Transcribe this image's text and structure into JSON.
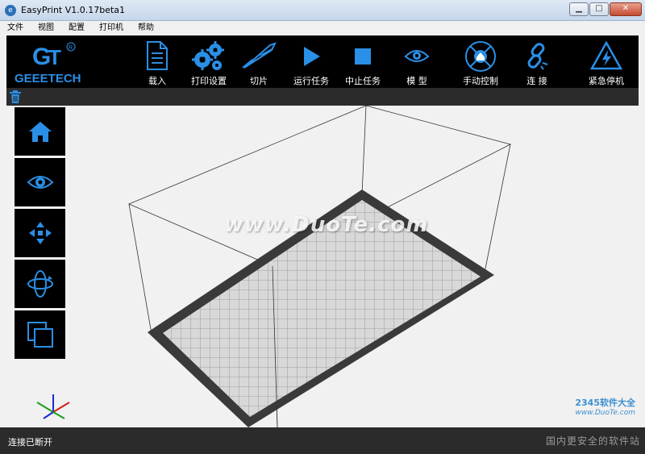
{
  "window": {
    "title": "EasyPrint    V1.0.17beta1"
  },
  "menu": [
    "文件",
    "视图",
    "配置",
    "打印机",
    "帮助"
  ],
  "logo": {
    "text": "GEEETECH",
    "mark": "GT"
  },
  "toolbar": {
    "load": "载入",
    "print_settings": "打印设置",
    "slice": "切片",
    "run_task": "运行任务",
    "stop_task": "中止任务",
    "model": "模 型",
    "manual_control": "手动控制",
    "connect": "连 接",
    "emergency_stop": "紧急停机"
  },
  "icons": {
    "load": "document-icon",
    "print_settings": "gears-icon",
    "slice": "knife-icon",
    "run_task": "play-icon",
    "stop_task": "stop-icon",
    "model": "eye-icon",
    "manual_control": "home-target-icon",
    "connect": "chain-link-icon",
    "emergency_stop": "warning-triangle-icon",
    "trash": "trash-icon",
    "side": [
      "home-icon",
      "eye-icon",
      "move-arrows-icon",
      "rotate-icon",
      "layers-icon"
    ]
  },
  "colors": {
    "accent": "#2a8fe6",
    "toolbar_bg": "#000000",
    "bar_bg": "#2b2b2b"
  },
  "watermark": "www.DuoTe.com",
  "watermark2": {
    "brand": "2345软件大全",
    "url": "www.DuoTe.com"
  },
  "status": {
    "text": "连接已断开",
    "slogan": "国内更安全的软件站"
  }
}
